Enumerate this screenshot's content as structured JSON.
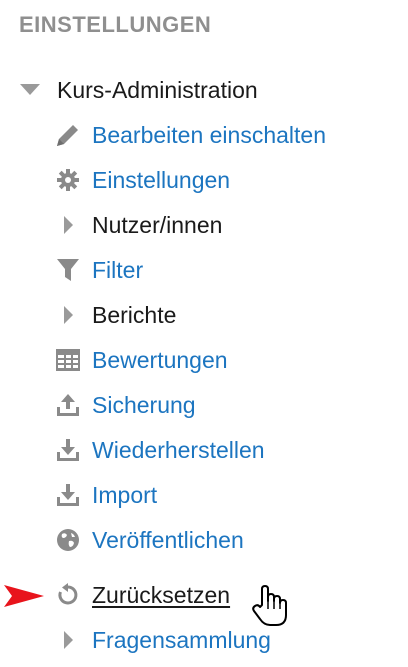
{
  "header": {
    "title": "EINSTELLUNGEN"
  },
  "tree": {
    "root_label": "Kurs-Administration",
    "items": [
      {
        "label": "Bearbeiten einschalten",
        "icon": "pencil-icon"
      },
      {
        "label": "Einstellungen",
        "icon": "gear-icon"
      },
      {
        "label": "Nutzer/innen",
        "icon": "caret-right-icon"
      },
      {
        "label": "Filter",
        "icon": "filter-icon"
      },
      {
        "label": "Berichte",
        "icon": "caret-right-icon"
      },
      {
        "label": "Bewertungen",
        "icon": "table-icon"
      },
      {
        "label": "Sicherung",
        "icon": "upload-icon"
      },
      {
        "label": "Wiederherstellen",
        "icon": "download-icon"
      },
      {
        "label": "Import",
        "icon": "download-icon"
      },
      {
        "label": "Veröffentlichen",
        "icon": "globe-icon"
      },
      {
        "label": "Zurücksetzen",
        "icon": "reset-icon"
      },
      {
        "label": "Fragensammlung",
        "icon": "caret-right-icon"
      }
    ]
  },
  "colors": {
    "link": "#1c75c0",
    "header": "#8f8f8f",
    "icon": "#8a8a8a",
    "pointer": "#e8141c"
  }
}
